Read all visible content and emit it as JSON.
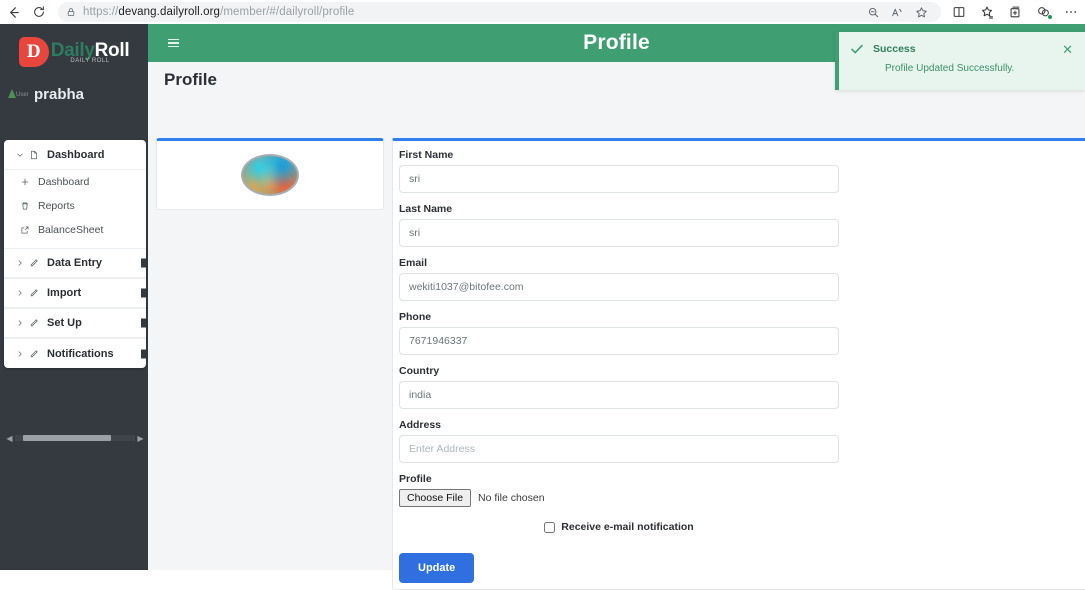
{
  "browser": {
    "url_prefix": "https://",
    "url_domain": "devang.dailyroll.org",
    "url_path": "/member/#/dailyroll/profile",
    "back_icon": "back-arrow-icon",
    "reload_icon": "reload-icon",
    "lock_icon": "lock-icon",
    "zoom_out_icon": "zoom-out-icon",
    "read_aloud_icon": "read-aloud-icon",
    "favorite_icon": "star-icon",
    "split_screen_icon": "split-screen-icon",
    "collections_icon": "collections-icon",
    "add_tab_group_icon": "add-tab-group-icon",
    "browser_essentials_icon": "browser-essentials-icon",
    "more_icon": "more-options-icon"
  },
  "sidebar": {
    "brand": {
      "mark": "D",
      "name_part1": "Daily",
      "name_part2": "Roll",
      "tagline": "DAILY ROLL"
    },
    "user": {
      "name": "prabha",
      "avatar_alt": "User"
    },
    "menu": [
      {
        "label": "Dashboard",
        "expanded": true,
        "chevron": "chevron-down-icon",
        "icon": "file-icon",
        "children": [
          {
            "label": "Dashboard",
            "icon": "plus-icon"
          },
          {
            "label": "Reports",
            "icon": "trash-icon"
          },
          {
            "label": "BalanceSheet",
            "icon": "external-link-icon"
          }
        ]
      },
      {
        "label": "Data Entry",
        "expanded": false,
        "chevron": "chevron-right-icon",
        "icon": "pencil-icon",
        "children": []
      },
      {
        "label": "Import",
        "expanded": false,
        "chevron": "chevron-right-icon",
        "icon": "pencil-icon",
        "children": []
      },
      {
        "label": "Set Up",
        "expanded": false,
        "chevron": "chevron-right-icon",
        "icon": "pencil-icon",
        "children": []
      },
      {
        "label": "Notifications",
        "expanded": false,
        "chevron": "chevron-right-icon",
        "icon": "pencil-icon",
        "children": []
      }
    ]
  },
  "header": {
    "menu_toggle_icon": "hamburger-icon",
    "title": "Profile",
    "accent_color": "#3f9e72"
  },
  "page": {
    "title": "Profile"
  },
  "form": {
    "accent_border_color": "#2f80ed",
    "fields": [
      {
        "label": "First Name",
        "value": "sri",
        "placeholder": "First Name",
        "name": "first-name"
      },
      {
        "label": "Last Name",
        "value": "sri",
        "placeholder": "Last Name",
        "name": "last-name"
      },
      {
        "label": "Email",
        "value": "wekiti1037@bitofee.com",
        "placeholder": "Email",
        "name": "email"
      },
      {
        "label": "Phone",
        "value": "7671946337",
        "placeholder": "Phone",
        "name": "phone"
      },
      {
        "label": "Country",
        "value": "india",
        "placeholder": "Country",
        "name": "country"
      },
      {
        "label": "Address",
        "value": "",
        "placeholder": "Enter Address",
        "name": "address"
      }
    ],
    "profile_label": "Profile",
    "file_button": "Choose File",
    "file_status": "No file chosen",
    "checkbox_label": "Receive e-mail notification",
    "checkbox_checked": false,
    "submit_label": "Update",
    "submit_color": "#2f6fe0"
  },
  "toast": {
    "title": "Success",
    "message": "Profile Updated Successfully.",
    "check_icon": "check-icon",
    "close_icon": "close-icon",
    "color": "#3f9e72"
  }
}
